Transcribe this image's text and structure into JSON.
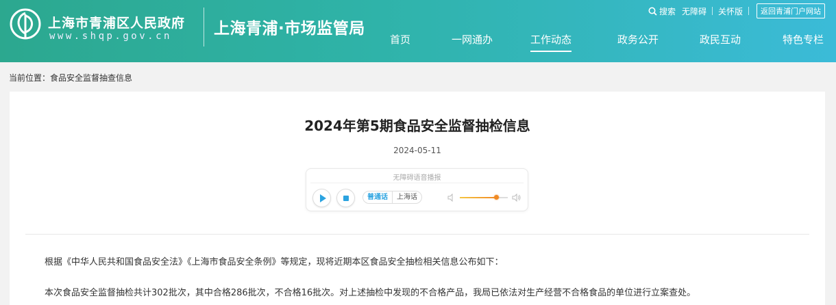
{
  "header": {
    "gov_name": "上海市青浦区人民政府",
    "gov_url": "www.shqp.gov.cn",
    "bureau": "上海青浦·市场监管局",
    "toplinks": {
      "search": "搜索",
      "accessible": "无障碍",
      "care": "关怀版",
      "portal": "返回青浦门户网站"
    },
    "nav": [
      {
        "label": "首页"
      },
      {
        "label": "一网通办"
      },
      {
        "label": "工作动态"
      },
      {
        "label": "政务公开"
      },
      {
        "label": "政民互动"
      },
      {
        "label": "特色专栏"
      }
    ],
    "active_nav": "工作动态"
  },
  "breadcrumb": "当前位置：食品安全监督抽查信息",
  "article": {
    "title": "2024年第5期食品安全监督抽检信息",
    "date": "2024-05-11",
    "player": {
      "label": "无障碍语音播报",
      "lang_primary": "普通话",
      "lang_secondary": "上海话",
      "volume": 0.75
    },
    "paragraphs": [
      "根据《中华人民共和国食品安全法》《上海市食品安全条例》等规定，现将近期本区食品安全抽检相关信息公布如下：",
      "本次食品安全监督抽检共计302批次，其中合格286批次，不合格16批次。对上述抽检中发现的不合格产品，我局已依法对生产经营不合格食品的单位进行立案查处。"
    ]
  },
  "colors": {
    "header_start": "#2ca88f",
    "header_end": "#3bbbd8",
    "accent": "#2ba3e0",
    "slider": "#f08a24"
  }
}
